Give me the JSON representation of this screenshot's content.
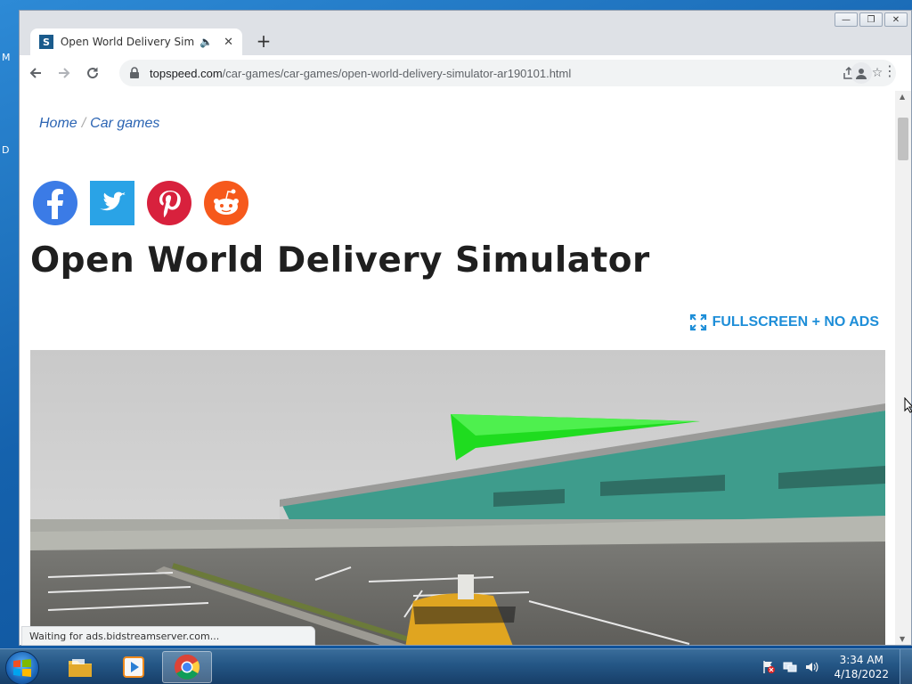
{
  "desktop": {
    "glyph_top": "M",
    "glyph_bottom": "D"
  },
  "browser": {
    "tab": {
      "favicon_letter": "S",
      "title": "Open World Delivery Simula"
    },
    "url": {
      "host": "topspeed.com",
      "path": "/car-games/car-games/open-world-delivery-simulator-ar190101.html"
    },
    "status_text": "Waiting for ads.bidstreamserver.com..."
  },
  "page": {
    "breadcrumb": {
      "home": "Home",
      "separator": "/",
      "category": "Car games"
    },
    "social": [
      {
        "name": "facebook",
        "color": "#3b7be6"
      },
      {
        "name": "twitter",
        "color": "#2aa3e6"
      },
      {
        "name": "pinterest",
        "color": "#d8213d"
      },
      {
        "name": "reddit",
        "color": "#f6591c"
      }
    ],
    "title": "Open World Delivery Simulator",
    "fullscreen_label": "FULLSCREEN + NO ADS"
  },
  "taskbar": {
    "clock_time": "3:34 AM",
    "clock_date": "4/18/2022",
    "pinned": [
      "explorer-icon",
      "media-player-icon",
      "chrome-icon"
    ]
  }
}
